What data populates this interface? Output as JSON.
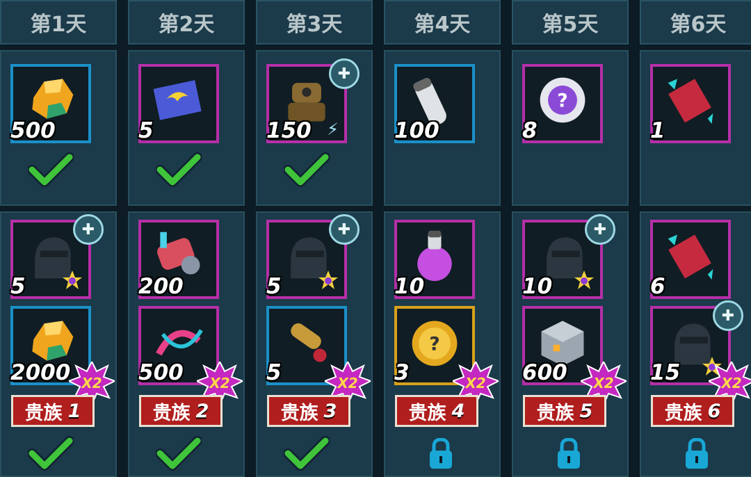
{
  "days": [
    {
      "label": "第1天",
      "free": {
        "item": "amber-crystal",
        "qty": "500",
        "border": "blue",
        "claimed": true
      },
      "vip_rewards": [
        {
          "item": "hero-silhouette",
          "qty": "5",
          "border": "purple",
          "puzzle": true,
          "star": true
        },
        {
          "item": "amber-crystal",
          "qty": "2000",
          "border": "blue",
          "x2": true
        }
      ],
      "vip_label": "贵族",
      "vip_level": "1",
      "vip_status": "claimed"
    },
    {
      "label": "第2天",
      "free": {
        "item": "winged-ticket",
        "qty": "5",
        "border": "purple",
        "claimed": true
      },
      "vip_rewards": [
        {
          "item": "cannon-arm",
          "qty": "200",
          "border": "purple"
        },
        {
          "item": "dna-helix",
          "qty": "500",
          "border": "purple",
          "x2": true
        }
      ],
      "vip_label": "贵族",
      "vip_level": "2",
      "vip_status": "claimed"
    },
    {
      "label": "第3天",
      "free": {
        "item": "robot-hero",
        "qty": "150",
        "border": "purple",
        "puzzle": true,
        "bolt": true,
        "claimed": true
      },
      "vip_rewards": [
        {
          "item": "hero-silhouette",
          "qty": "5",
          "border": "purple",
          "puzzle": true,
          "star": true
        },
        {
          "item": "gold-scroll",
          "qty": "5",
          "border": "blue",
          "x2": true
        }
      ],
      "vip_label": "贵族",
      "vip_level": "3",
      "vip_status": "claimed"
    },
    {
      "label": "第4天",
      "free": {
        "item": "white-vial",
        "qty": "100",
        "border": "blue",
        "claimed": false
      },
      "vip_rewards": [
        {
          "item": "purple-flask",
          "qty": "10",
          "border": "purple"
        },
        {
          "item": "mystery-gold-coin",
          "qty": "3",
          "border": "gold",
          "x2": true
        }
      ],
      "vip_label": "贵族",
      "vip_level": "4",
      "vip_status": "locked"
    },
    {
      "label": "第5天",
      "free": {
        "item": "mystery-chip",
        "qty": "8",
        "border": "purple",
        "claimed": false
      },
      "vip_rewards": [
        {
          "item": "hero-silhouette",
          "qty": "10",
          "border": "purple",
          "puzzle": true,
          "star": true
        },
        {
          "item": "metal-cube",
          "qty": "600",
          "border": "purple",
          "x2": true
        }
      ],
      "vip_label": "贵族",
      "vip_level": "5",
      "vip_status": "locked"
    },
    {
      "label": "第6天",
      "free": {
        "item": "red-scroll",
        "qty": "1",
        "border": "purple",
        "claimed": false
      },
      "vip_rewards": [
        {
          "item": "red-scroll",
          "qty": "6",
          "border": "purple"
        },
        {
          "item": "hero-silhouette",
          "qty": "15",
          "border": "purple",
          "puzzle": true,
          "star": true,
          "x2": true
        }
      ],
      "vip_label": "贵族",
      "vip_level": "6",
      "vip_status": "locked"
    }
  ],
  "x2_text": "X2",
  "colors": {
    "blue": "#1b90c8",
    "purple": "#b52fa8",
    "gold": "#d7a11c",
    "check": "#3fc43a",
    "lock": "#19a7d6",
    "vip": "#b01e1e"
  }
}
